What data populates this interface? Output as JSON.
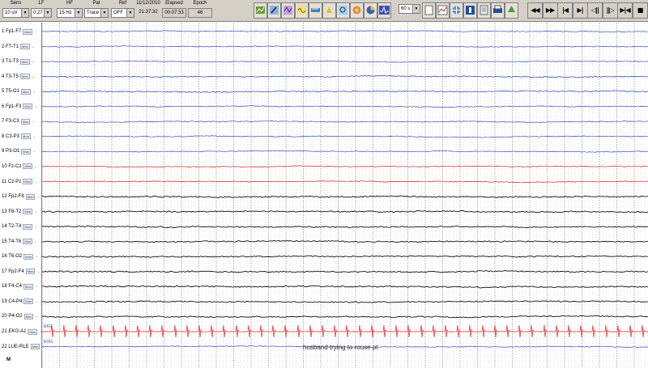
{
  "toolbar": {
    "sens": {
      "label": "Sens",
      "value": "10 uV"
    },
    "lf": {
      "label": "LF",
      "value": "0.27 Hz"
    },
    "hf": {
      "label": "HF",
      "value": "15 Hz"
    },
    "pat": {
      "label": "Pat",
      "value": "Trace"
    },
    "ref": {
      "label": "Ref",
      "value": "OFF"
    },
    "date": {
      "label": "11/12/2010",
      "value": "21:37:32"
    },
    "elapsed": {
      "label": "Elapsed",
      "value": "00:07:33"
    },
    "epoch": {
      "label": "Epoch",
      "value": "46"
    },
    "page_len": {
      "value": "60 s"
    },
    "tools_a": [
      "montage-icon",
      "edit-icon",
      "filter-icon",
      "waveform-icon",
      "ruler-icon",
      "bell-icon",
      "zoom-icon",
      "globe-icon",
      "pie-icon",
      "spike-icon"
    ],
    "tools_b": [
      "blank-page-icon",
      "channel-icon",
      "globe2-icon",
      "person-icon",
      "page-icon",
      "print-icon",
      "recycle-icon"
    ],
    "nav": [
      "◀◀",
      "▶▶",
      "|◀",
      "▶|",
      "◁||",
      "||▷",
      "▶|◀",
      "■"
    ]
  },
  "channels": [
    {
      "label": "1 Fp1-F7",
      "color": "#3a4fb0"
    },
    {
      "label": "2 F7-T1",
      "color": "#3a4fb0"
    },
    {
      "label": "3 T1-T3",
      "color": "#3a4fb0"
    },
    {
      "label": "4 T3-T5",
      "color": "#2338a8"
    },
    {
      "label": "5 T5-O1",
      "color": "#2338a8"
    },
    {
      "label": "6 Fp1-F3",
      "color": "#3a4fb0"
    },
    {
      "label": "7 F3-C3",
      "color": "#3a4fb0"
    },
    {
      "label": "8 C3-P3",
      "color": "#3a4fb0"
    },
    {
      "label": "9 P3-O1",
      "color": "#3a4fb0"
    },
    {
      "label": "10 Fz-Cz",
      "color": "#d02020"
    },
    {
      "label": "11 Cz-Pz",
      "color": "#d02020"
    },
    {
      "label": "12 Fp2-F8",
      "color": "#111111"
    },
    {
      "label": "13 F8-T2",
      "color": "#111111"
    },
    {
      "label": "14 T2-T4",
      "color": "#111111"
    },
    {
      "label": "15 T4-T6",
      "color": "#111111"
    },
    {
      "label": "16 T6-O2",
      "color": "#111111"
    },
    {
      "label": "17 Fp2-F4",
      "color": "#111111"
    },
    {
      "label": "18 F4-C4",
      "color": "#111111"
    },
    {
      "label": "19 C4-P4",
      "color": "#111111"
    },
    {
      "label": "20 P4-O2",
      "color": "#111111"
    },
    {
      "label": "21 EKG-A1",
      "color": "#e02020"
    },
    {
      "label": "22 LUE-RLE",
      "color": "#3a4fb0"
    }
  ],
  "channel_button": "Mon",
  "ekg_tag": "EKG",
  "eog_tag": "EOG",
  "annotation": "husband trying to rouse pt",
  "bottom_marker": "M",
  "grid_color": "#b8b8b8"
}
